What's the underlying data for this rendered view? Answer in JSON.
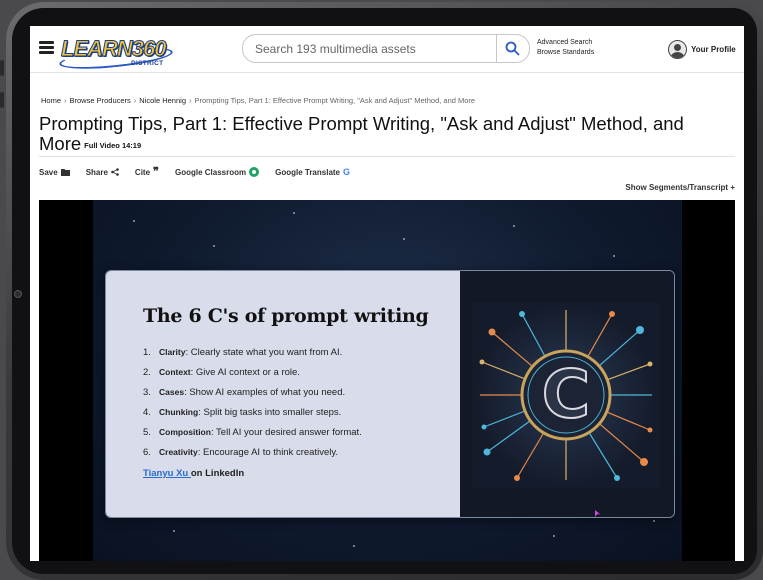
{
  "header": {
    "logo_text": "LEARN360",
    "logo_subtext": "DISTRICT",
    "search_placeholder": "Search 193 multimedia assets",
    "advanced_search": "Advanced Search",
    "browse_standards": "Browse Standards",
    "profile_label": "Your Profile"
  },
  "breadcrumb": {
    "items": [
      "Home",
      "Browse Producers",
      "Nicole Hennig"
    ],
    "current": "Prompting Tips, Part 1: Effective Prompt Writing, \"Ask and Adjust\" Method, and More"
  },
  "page": {
    "title": "Prompting Tips, Part 1: Effective Prompt Writing, \"Ask and Adjust\" Method, and More",
    "badge": "Full Video 14:19"
  },
  "toolbar": {
    "save": "Save",
    "share": "Share",
    "cite": "Cite",
    "classroom": "Google Classroom",
    "translate": "Google Translate",
    "segments": "Show Segments/Transcript +"
  },
  "slide": {
    "title": "The 6 C's of prompt writing",
    "items": [
      {
        "num": "1.",
        "term": "Clarity",
        "text": ": Clearly state what you want from AI."
      },
      {
        "num": "2.",
        "term": "Context",
        "text": ": Give AI context or a role."
      },
      {
        "num": "3.",
        "term": "Cases",
        "text": ": Show AI examples of what you need."
      },
      {
        "num": "4.",
        "term": "Chunking",
        "text": ": Split big tasks into smaller steps."
      },
      {
        "num": "5.",
        "term": "Composition",
        "text": ": Tell AI your desired answer format."
      },
      {
        "num": "6.",
        "term": "Creativity",
        "text": ": Encourage AI to think creatively."
      }
    ],
    "credit_name": "Tianyu Xu ",
    "credit_suffix": "on LinkedIn",
    "art_letter": "C"
  },
  "icons": {
    "menu": "hamburger-menu-icon",
    "search": "search-icon",
    "profile": "user-avatar-icon",
    "save": "folder-icon",
    "share": "share-icon",
    "cite": "quote-icon",
    "classroom": "google-classroom-icon",
    "translate": "google-g-icon"
  },
  "colors": {
    "accent_link": "#2a6cc9",
    "logo_yellow": "#f2c230",
    "logo_blue": "#1b3f8f",
    "classroom_green": "#1fa463",
    "google_blue": "#4285f4"
  }
}
